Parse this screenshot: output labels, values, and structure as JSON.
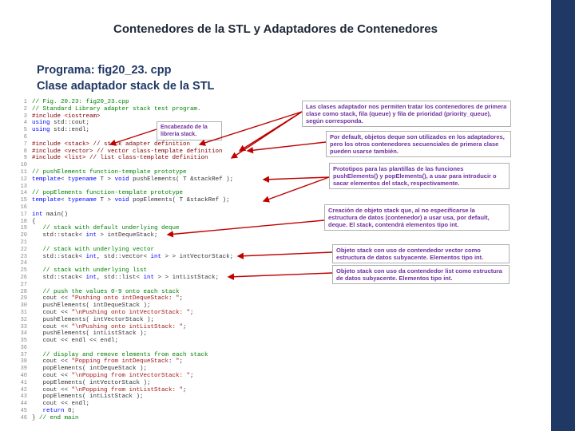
{
  "title": "Contenedores de la STL y Adaptadores de Contenedores",
  "program_label": "Programa: fig20_23. cpp",
  "class_label": "Clase adaptador stack de la STL",
  "code": [
    "// Fig. 20.23: fig20_23.cpp",
    "// Standard Library adapter stack test program.",
    "#include <iostream>",
    "using std::cout;",
    "using std::endl;",
    "",
    "#include <stack> // stack adapter definition",
    "#include <vector> // vector class-template definition",
    "#include <list> // list class-template definition",
    "",
    "// pushElements function-template prototype",
    "template< typename T > void pushElements( T &stackRef );",
    "",
    "// popElements function-template prototype",
    "template< typename T > void popElements( T &stackRef );",
    "",
    "int main()",
    "{",
    "   // stack with default underlying deque",
    "   std::stack< int > intDequeStack;",
    "",
    "   // stack with underlying vector",
    "   std::stack< int, std::vector< int > > intVectorStack;",
    "",
    "   // stack with underlying list",
    "   std::stack< int, std::list< int > > intListStack;",
    "",
    "   // push the values 0-9 onto each stack",
    "   cout << \"Pushing onto intDequeStack: \";",
    "   pushElements( intDequeStack );",
    "   cout << \"\\nPushing onto intVectorStack: \";",
    "   pushElements( intVectorStack );",
    "   cout << \"\\nPushing onto intListStack: \";",
    "   pushElements( intListStack );",
    "   cout << endl << endl;",
    "",
    "   // display and remove elements from each stack",
    "   cout << \"Popping from intDequeStack: \";",
    "   popElements( intDequeStack );",
    "   cout << \"\\nPopping from intVectorStack: \";",
    "   popElements( intVectorStack );",
    "   cout << \"\\nPopping from intListStack: \";",
    "   popElements( intListStack );",
    "   cout << endl;",
    "   return 0;",
    "} // end main"
  ],
  "callouts": {
    "header": "Encabezado de la librería stack.",
    "adapters": "Las clases adaptador nos permiten tratar los contenedores de primera clase como stack, fila (queue) y fila de prioridad (priority_queue), según corresponda.",
    "deque_default": "Por default, objetos deque son utilizados en los adaptadores, pero los otros contenedores secuenciales de primera clase pueden usarse también.",
    "prototypes": "Prototipos para las plantillas de las funciones pushElements() y popElements(), a usar para introducir o sacar elementos del stack, respectivamente.",
    "default_stack": "Creación de objeto stack que, al no especificarse la estructura de datos (contenedor) a usar usa, por default, deque. El stack, contendrá elementos tipo int.",
    "vector_stack": "Objeto stack con uso de contendedor vector como estructura de datos subyacente. Elementos tipo int.",
    "list_stack": "Objeto stack con uso da contendedor list como estructura de datos subyacente. Elementos tipo int."
  }
}
